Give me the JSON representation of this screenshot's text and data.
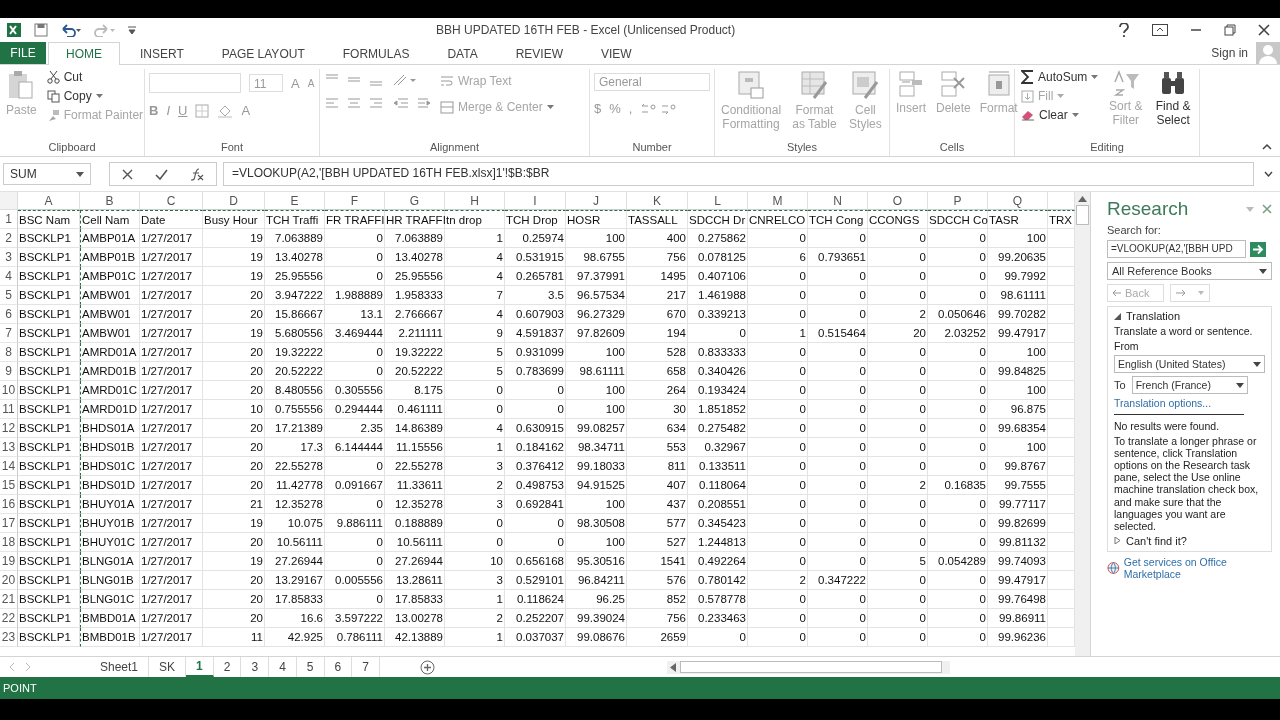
{
  "window": {
    "title": "BBH UPDATED 16TH FEB - Excel (Unlicensed Product)",
    "sign_in": "Sign in"
  },
  "tabs": [
    {
      "label": "FILE",
      "kind": "file",
      "selected": false
    },
    {
      "label": "HOME",
      "kind": "tab",
      "selected": true
    },
    {
      "label": "INSERT",
      "kind": "tab",
      "selected": false
    },
    {
      "label": "PAGE LAYOUT",
      "kind": "tab",
      "selected": false
    },
    {
      "label": "FORMULAS",
      "kind": "tab",
      "selected": false
    },
    {
      "label": "DATA",
      "kind": "tab",
      "selected": false
    },
    {
      "label": "REVIEW",
      "kind": "tab",
      "selected": false
    },
    {
      "label": "VIEW",
      "kind": "tab",
      "selected": false
    }
  ],
  "ribbon": {
    "clipboard": {
      "label": "Clipboard",
      "paste": {
        "label": "Paste",
        "disabled": true
      },
      "cut": {
        "label": "Cut",
        "disabled": false
      },
      "copy": {
        "label": "Copy",
        "disabled": false
      },
      "format_painter": {
        "label": "Format Painter",
        "disabled": true
      }
    },
    "font": {
      "label": "Font",
      "size": "11",
      "grow": "A",
      "shrink": "A",
      "bold": "B",
      "italic": "I",
      "underline": "U",
      "font_color": "A"
    },
    "alignment": {
      "label": "Alignment",
      "wrap_text": {
        "label": "Wrap Text",
        "disabled": true
      },
      "merge_center": {
        "label": "Merge & Center",
        "disabled": true
      }
    },
    "number": {
      "label": "Number",
      "format": "General",
      "currency": "$",
      "percent": "%",
      "comma": ","
    },
    "styles": {
      "label": "Styles",
      "conditional": {
        "label": "Conditional Formatting",
        "disabled": true
      },
      "format_table": {
        "label": "Format as Table",
        "disabled": true
      },
      "cell_styles": {
        "label": "Cell Styles",
        "disabled": true
      }
    },
    "cells": {
      "label": "Cells",
      "insert": {
        "label": "Insert",
        "disabled": true
      },
      "delete": {
        "label": "Delete",
        "disabled": true
      },
      "format": {
        "label": "Format",
        "disabled": true
      }
    },
    "editing": {
      "label": "Editing",
      "autosum": {
        "label": "AutoSum",
        "disabled": false
      },
      "fill": {
        "label": "Fill",
        "disabled": true
      },
      "clear": {
        "label": "Clear",
        "disabled": false
      },
      "sort_filter": {
        "label": "Sort & Filter",
        "disabled": true
      },
      "find_select": {
        "label": "Find & Select",
        "disabled": false
      }
    }
  },
  "formula_bar": {
    "name_box": "SUM",
    "formula": "=VLOOKUP(A2,'[BBH UPDATED 16TH FEB.xlsx]1'!$B:$BR"
  },
  "grid": {
    "columns": [
      {
        "letter": "A",
        "kind": "text"
      },
      {
        "letter": "B",
        "kind": "text"
      },
      {
        "letter": "C",
        "kind": "text"
      },
      {
        "letter": "D",
        "kind": "number"
      },
      {
        "letter": "E",
        "kind": "number"
      },
      {
        "letter": "F",
        "kind": "number"
      },
      {
        "letter": "G",
        "kind": "number"
      },
      {
        "letter": "H",
        "kind": "number"
      },
      {
        "letter": "I",
        "kind": "number"
      },
      {
        "letter": "J",
        "kind": "number"
      },
      {
        "letter": "K",
        "kind": "number"
      },
      {
        "letter": "L",
        "kind": "number"
      },
      {
        "letter": "M",
        "kind": "number"
      },
      {
        "letter": "N",
        "kind": "number"
      },
      {
        "letter": "O",
        "kind": "number"
      },
      {
        "letter": "P",
        "kind": "number"
      },
      {
        "letter": "Q",
        "kind": "number"
      },
      {
        "kind": "text"
      }
    ],
    "header_row": {
      "number": "1",
      "cells": [
        "BSC Nam",
        "Cell Nam",
        "Date",
        "Busy Hour",
        "TCH Traffi",
        "FR TRAFFI",
        "HR TRAFFI",
        "tn drop",
        "TCH Drop",
        "HOSR",
        "TASSALL",
        "SDCCH Dr",
        "CNRELCO",
        "TCH Cong",
        "CCONGS",
        "SDCCH Co",
        "TASR",
        "TRX"
      ]
    },
    "rows": [
      {
        "number": "2",
        "cells": [
          "BSCKLP1",
          "AMBP01A",
          "1/27/2017",
          "19",
          "7.063889",
          "0",
          "7.063889",
          "1",
          "0.25974",
          "100",
          "400",
          "0.275862",
          "0",
          "0",
          "0",
          "0",
          "100"
        ]
      },
      {
        "number": "3",
        "cells": [
          "BSCKLP1",
          "AMBP01B",
          "1/27/2017",
          "19",
          "13.40278",
          "0",
          "13.40278",
          "4",
          "0.531915",
          "98.6755",
          "756",
          "0.078125",
          "6",
          "0.793651",
          "0",
          "0",
          "99.20635"
        ]
      },
      {
        "number": "4",
        "cells": [
          "BSCKLP1",
          "AMBP01C",
          "1/27/2017",
          "19",
          "25.95556",
          "0",
          "25.95556",
          "4",
          "0.265781",
          "97.37991",
          "1495",
          "0.407106",
          "0",
          "0",
          "0",
          "0",
          "99.7992"
        ]
      },
      {
        "number": "5",
        "cells": [
          "BSCKLP1",
          "AMBW01",
          "1/27/2017",
          "20",
          "3.947222",
          "1.988889",
          "1.958333",
          "7",
          "3.5",
          "96.57534",
          "217",
          "1.461988",
          "0",
          "0",
          "0",
          "0",
          "98.61111"
        ]
      },
      {
        "number": "6",
        "cells": [
          "BSCKLP1",
          "AMBW01",
          "1/27/2017",
          "20",
          "15.86667",
          "13.1",
          "2.766667",
          "4",
          "0.607903",
          "96.27329",
          "670",
          "0.339213",
          "0",
          "0",
          "2",
          "0.050646",
          "99.70282"
        ]
      },
      {
        "number": "7",
        "cells": [
          "BSCKLP1",
          "AMBW01",
          "1/27/2017",
          "19",
          "5.680556",
          "3.469444",
          "2.211111",
          "9",
          "4.591837",
          "97.82609",
          "194",
          "0",
          "1",
          "0.515464",
          "20",
          "2.03252",
          "99.47917"
        ]
      },
      {
        "number": "8",
        "cells": [
          "BSCKLP1",
          "AMRD01A",
          "1/27/2017",
          "20",
          "19.32222",
          "0",
          "19.32222",
          "5",
          "0.931099",
          "100",
          "528",
          "0.833333",
          "0",
          "0",
          "0",
          "0",
          "100"
        ]
      },
      {
        "number": "9",
        "cells": [
          "BSCKLP1",
          "AMRD01B",
          "1/27/2017",
          "20",
          "20.52222",
          "0",
          "20.52222",
          "5",
          "0.783699",
          "98.61111",
          "658",
          "0.340426",
          "0",
          "0",
          "0",
          "0",
          "99.84825"
        ]
      },
      {
        "number": "10",
        "cells": [
          "BSCKLP1",
          "AMRD01C",
          "1/27/2017",
          "20",
          "8.480556",
          "0.305556",
          "8.175",
          "0",
          "0",
          "100",
          "264",
          "0.193424",
          "0",
          "0",
          "0",
          "0",
          "100"
        ]
      },
      {
        "number": "11",
        "cells": [
          "BSCKLP1",
          "AMRD01D",
          "1/27/2017",
          "10",
          "0.755556",
          "0.294444",
          "0.461111",
          "0",
          "0",
          "100",
          "30",
          "1.851852",
          "0",
          "0",
          "0",
          "0",
          "96.875"
        ]
      },
      {
        "number": "12",
        "cells": [
          "BSCKLP1",
          "BHDS01A",
          "1/27/2017",
          "20",
          "17.21389",
          "2.35",
          "14.86389",
          "4",
          "0.630915",
          "99.08257",
          "634",
          "0.275482",
          "0",
          "0",
          "0",
          "0",
          "99.68354"
        ]
      },
      {
        "number": "13",
        "cells": [
          "BSCKLP1",
          "BHDS01B",
          "1/27/2017",
          "20",
          "17.3",
          "6.144444",
          "11.15556",
          "1",
          "0.184162",
          "98.34711",
          "553",
          "0.32967",
          "0",
          "0",
          "0",
          "0",
          "100"
        ]
      },
      {
        "number": "14",
        "cells": [
          "BSCKLP1",
          "BHDS01C",
          "1/27/2017",
          "20",
          "22.55278",
          "0",
          "22.55278",
          "3",
          "0.376412",
          "99.18033",
          "811",
          "0.133511",
          "0",
          "0",
          "0",
          "0",
          "99.8767"
        ]
      },
      {
        "number": "15",
        "cells": [
          "BSCKLP1",
          "BHDS01D",
          "1/27/2017",
          "20",
          "11.42778",
          "0.091667",
          "11.33611",
          "2",
          "0.498753",
          "94.91525",
          "407",
          "0.118064",
          "0",
          "0",
          "2",
          "0.16835",
          "99.7555"
        ]
      },
      {
        "number": "16",
        "cells": [
          "BSCKLP1",
          "BHUY01A",
          "1/27/2017",
          "21",
          "12.35278",
          "0",
          "12.35278",
          "3",
          "0.692841",
          "100",
          "437",
          "0.208551",
          "0",
          "0",
          "0",
          "0",
          "99.77117"
        ]
      },
      {
        "number": "17",
        "cells": [
          "BSCKLP1",
          "BHUY01B",
          "1/27/2017",
          "19",
          "10.075",
          "9.886111",
          "0.188889",
          "0",
          "0",
          "98.30508",
          "577",
          "0.345423",
          "0",
          "0",
          "0",
          "0",
          "99.82699"
        ]
      },
      {
        "number": "18",
        "cells": [
          "BSCKLP1",
          "BHUY01C",
          "1/27/2017",
          "20",
          "10.56111",
          "0",
          "10.56111",
          "0",
          "0",
          "100",
          "527",
          "1.244813",
          "0",
          "0",
          "0",
          "0",
          "99.81132"
        ]
      },
      {
        "number": "19",
        "cells": [
          "BSCKLP1",
          "BLNG01A",
          "1/27/2017",
          "19",
          "27.26944",
          "0",
          "27.26944",
          "10",
          "0.656168",
          "95.30516",
          "1541",
          "0.492264",
          "0",
          "0",
          "5",
          "0.054289",
          "99.74093"
        ]
      },
      {
        "number": "20",
        "cells": [
          "BSCKLP1",
          "BLNG01B",
          "1/27/2017",
          "20",
          "13.29167",
          "0.005556",
          "13.28611",
          "3",
          "0.529101",
          "96.84211",
          "576",
          "0.780142",
          "2",
          "0.347222",
          "0",
          "0",
          "99.47917"
        ]
      },
      {
        "number": "21",
        "cells": [
          "BSCKLP1",
          "BLNG01C",
          "1/27/2017",
          "20",
          "17.85833",
          "0",
          "17.85833",
          "1",
          "0.118624",
          "96.25",
          "852",
          "0.578778",
          "0",
          "0",
          "0",
          "0",
          "99.76498"
        ]
      },
      {
        "number": "22",
        "cells": [
          "BSCKLP1",
          "BMBD01A",
          "1/27/2017",
          "20",
          "16.6",
          "3.597222",
          "13.00278",
          "2",
          "0.252207",
          "99.39024",
          "756",
          "0.233463",
          "0",
          "0",
          "0",
          "0",
          "99.86911"
        ]
      },
      {
        "number": "23",
        "cells": [
          "BSCKLP1",
          "BMBD01B",
          "1/27/2017",
          "11",
          "42.925",
          "0.786111",
          "42.13889",
          "1",
          "0.037037",
          "99.08676",
          "2659",
          "0",
          "0",
          "0",
          "0",
          "0",
          "99.96236"
        ]
      }
    ]
  },
  "sheet_tabs": [
    {
      "label": "Sheet1",
      "selected": false
    },
    {
      "label": "SK",
      "selected": false
    },
    {
      "label": "1",
      "selected": true
    },
    {
      "label": "2",
      "selected": false
    },
    {
      "label": "3",
      "selected": false
    },
    {
      "label": "4",
      "selected": false
    },
    {
      "label": "5",
      "selected": false
    },
    {
      "label": "6",
      "selected": false
    },
    {
      "label": "7",
      "selected": false
    }
  ],
  "status_bar": {
    "mode": "POINT"
  },
  "research": {
    "title": "Research",
    "search_label": "Search for:",
    "search_value": "=VLOOKUP(A2,'[BBH UPD",
    "source": "All Reference Books",
    "back": {
      "label": "Back",
      "disabled": true
    },
    "translation": {
      "title": "Translation",
      "expanded": true,
      "intro": "Translate a word or sentence.",
      "from_label": "From",
      "from": "English (United States)",
      "to_label": "To",
      "to": "French (France)",
      "options_link": "Translation options...",
      "no_results": "No results were found.",
      "help": "To translate a longer phrase or sentence, click Translation options on the Research task pane, select the Use online machine translation check box, and make sure that the languages you want are selected.",
      "cant_find": "Can't find it?",
      "cant_find_expanded": false
    },
    "services_link": "Get services on Office Marketplace"
  }
}
